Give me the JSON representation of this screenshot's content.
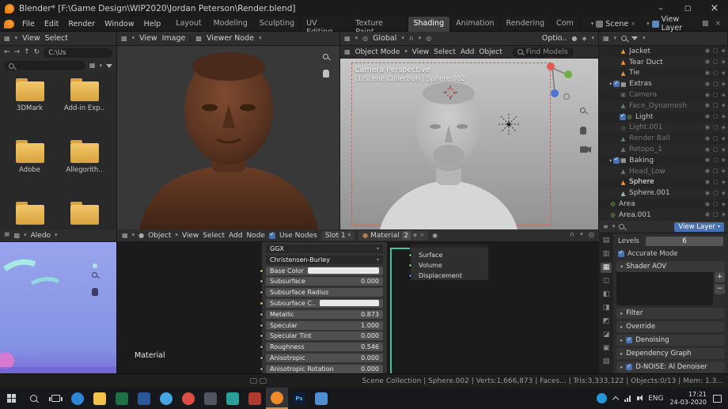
{
  "window": {
    "title": "Blender* [F:\\Game Design\\WIP2020\\Jordan Peterson\\Render.blend]"
  },
  "topbar": {
    "menus": [
      "File",
      "Edit",
      "Render",
      "Window",
      "Help"
    ],
    "workspaces": [
      "Layout",
      "Modeling",
      "Sculpting",
      "UV Editing",
      "Texture Paint",
      "Shading",
      "Animation",
      "Rendering",
      "Com"
    ],
    "scene_name": "Scene",
    "view_layer_name": "View Layer"
  },
  "file_browser": {
    "menu_view": "View",
    "menu_select": "Select",
    "path": "C:\\Us",
    "folders": [
      "3DMark",
      "Add-in Exp..",
      "Adobe",
      "Allegorith..",
      "",
      ""
    ]
  },
  "image_editor": {
    "menu_view": "View",
    "menu_image": "Image",
    "image_name": "Viewer Node"
  },
  "viewport": {
    "orientation": "Global",
    "options": "Optio..",
    "mode": "Object Mode",
    "menu_view": "View",
    "menu_select": "Select",
    "menu_add": "Add",
    "menu_object": "Object",
    "search": "Find Models",
    "view_label": "Camera Perspective",
    "context": "(1)Scene Collection | Sphere.002"
  },
  "outliner": {
    "rows": [
      {
        "label": "Jacket"
      },
      {
        "label": "Tear Duct"
      },
      {
        "label": "Tie"
      },
      {
        "label": "Extras"
      },
      {
        "label": "Camera"
      },
      {
        "label": "Face_Dynamesh"
      },
      {
        "label": "Light"
      },
      {
        "label": "Light.001"
      },
      {
        "label": "Render Ball"
      },
      {
        "label": "Retopo_1"
      },
      {
        "label": "Baking"
      },
      {
        "label": "Head_Low"
      },
      {
        "label": "Sphere"
      },
      {
        "label": "Sphere.001"
      },
      {
        "label": "Area"
      },
      {
        "label": "Area.001"
      }
    ]
  },
  "properties": {
    "header_value": "View Layer",
    "levels_label": "Levels",
    "levels_value": "6",
    "accurate_mode": "Accurate Mode",
    "shader_aov": "Shader AOV",
    "filter": "Filter",
    "override": "Override",
    "denoising": "Denoising",
    "dependency_graph": "Dependency Graph",
    "dnoise": "D-NOISE: AI Denoiser"
  },
  "shader_editor": {
    "target": "Object",
    "menu_view": "View",
    "menu_select": "Select",
    "menu_add": "Add",
    "menu_node": "Node",
    "use_nodes": "Use Nodes",
    "slot": "Slot 1",
    "material": "Material",
    "users": "2",
    "frame_label": "Material",
    "rows": [
      {
        "label": "GGX",
        "value": ""
      },
      {
        "label": "Christensen-Burley",
        "value": ""
      },
      {
        "label": "Base Color",
        "value": ""
      },
      {
        "label": "Subsurface",
        "value": "0.000"
      },
      {
        "label": "Subsurface Radius",
        "value": ""
      },
      {
        "label": "Subsurface C..",
        "value": ""
      },
      {
        "label": "Metallic",
        "value": "0.873"
      },
      {
        "label": "Specular",
        "value": "1.000"
      },
      {
        "label": "Specular Tint",
        "value": "0.000"
      },
      {
        "label": "Roughness",
        "value": "0.546"
      },
      {
        "label": "Anisotropic",
        "value": "0.000"
      },
      {
        "label": "Anisotropic Rotation",
        "value": "0.000"
      }
    ],
    "outputs": [
      "Surface",
      "Volume",
      "Displacement"
    ]
  },
  "bottom_image_editor": {
    "image_name": "Aledo"
  },
  "status_bar": {
    "text": "Scene Collection | Sphere.002 | Verts:1,666,873 | Faces... | Tris:3,333,122 | Objects:0/13 | Mem: 1.3..."
  },
  "taskbar": {
    "apps": [
      {
        "name": "edge",
        "color": "#2e86d6",
        "label": ""
      },
      {
        "name": "file-explorer",
        "color": "#f2c14b",
        "label": ""
      },
      {
        "name": "excel",
        "color": "#1e7145",
        "label": ""
      },
      {
        "name": "word",
        "color": "#2b579a",
        "label": ""
      },
      {
        "name": "skype",
        "color": "#45a6e0",
        "label": ""
      },
      {
        "name": "chrome",
        "color": "#dd4f43",
        "label": ""
      },
      {
        "name": "app-dark",
        "color": "#50555f",
        "label": ""
      },
      {
        "name": "app-teal",
        "color": "#2aa198",
        "label": ""
      },
      {
        "name": "app-red",
        "color": "#b03a2e",
        "label": ""
      },
      {
        "name": "blender",
        "color": "#ef8b2a",
        "label": ""
      },
      {
        "name": "photoshop",
        "color": "#0d1d33",
        "label": "Ps"
      },
      {
        "name": "app-blue",
        "color": "#4f8fd2",
        "label": ""
      }
    ],
    "tray": {
      "lang": "ENG",
      "time": "17:21",
      "date": "24-03-2020"
    }
  }
}
